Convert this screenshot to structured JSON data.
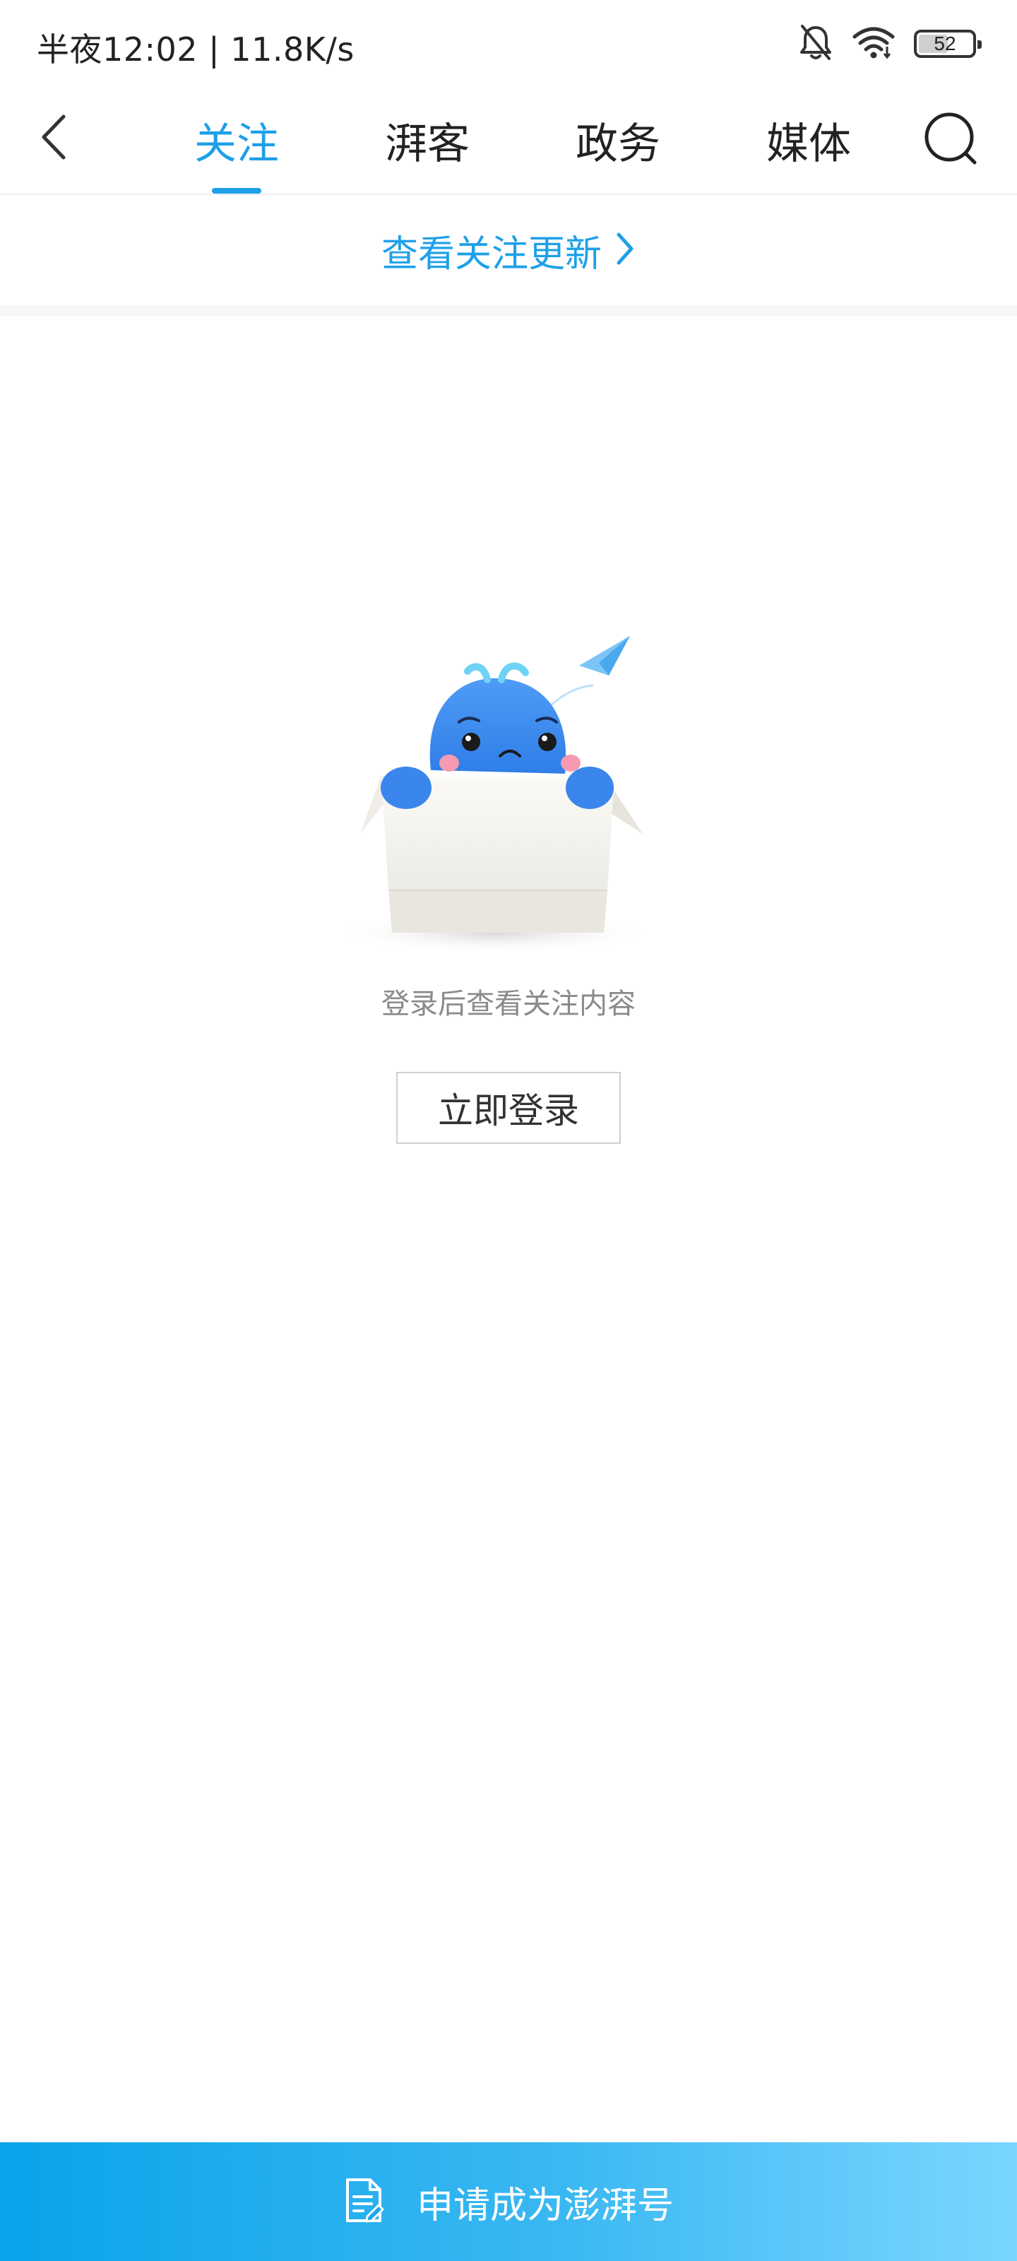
{
  "status_bar": {
    "time_speed": "半夜12:02 | 11.8K/s",
    "battery_level": "52",
    "battery_fraction": 0.52,
    "icons": [
      "bell-muted-icon",
      "wifi-icon",
      "battery-icon"
    ]
  },
  "nav": {
    "back_icon": "chevron-left-icon",
    "tabs": [
      {
        "label": "关注",
        "active": true
      },
      {
        "label": "湃客",
        "active": false
      },
      {
        "label": "政务",
        "active": false
      },
      {
        "label": "媒体",
        "active": false
      }
    ],
    "search_icon": "search-icon"
  },
  "updates": {
    "label": "查看关注更新",
    "icon": "chevron-right-icon"
  },
  "empty_state": {
    "illustration": "whale-in-box-illustration",
    "message": "登录后查看关注内容",
    "login_label": "立即登录"
  },
  "apply_bar": {
    "icon": "document-edit-icon",
    "label": "申请成为澎湃号"
  },
  "colors": {
    "accent": "#1ea0e8",
    "text": "#222222",
    "muted": "#8a8a8a",
    "bar_start": "#0aa3ea",
    "bar_end": "#7ad6ff"
  }
}
